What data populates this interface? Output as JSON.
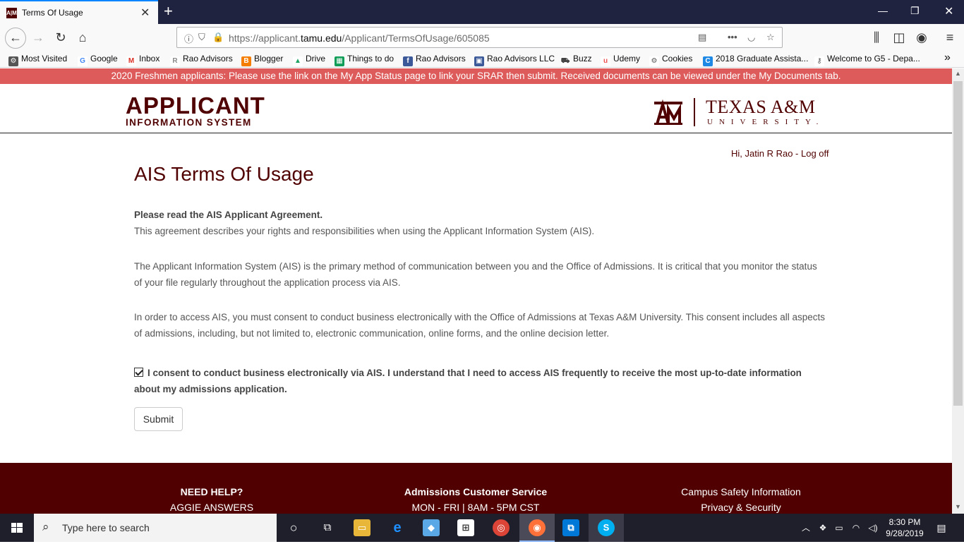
{
  "browser": {
    "tab_title": "Terms Of Usage",
    "tab_favicon": "A|M",
    "url_prefix": "https://applicant.",
    "url_domain": "tamu.edu",
    "url_path": "/Applicant/TermsOfUsage/605085",
    "bookmarks": [
      {
        "label": "Most Visited",
        "icon": "gear-icon",
        "color": "#555555"
      },
      {
        "label": "Google",
        "icon": "google-icon",
        "color": "#4285f4"
      },
      {
        "label": "Inbox",
        "icon": "gmail-icon",
        "color": "#d93025"
      },
      {
        "label": "Rao Advisors",
        "icon": "rao-icon",
        "color": "#8a8a8a"
      },
      {
        "label": "Blogger",
        "icon": "blogger-icon",
        "color": "#f57d00"
      },
      {
        "label": "Drive",
        "icon": "drive-icon",
        "color": "#1fa463"
      },
      {
        "label": "Things to do",
        "icon": "sheets-icon",
        "color": "#0f9d58"
      },
      {
        "label": "Rao Advisors",
        "icon": "facebook-icon",
        "color": "#3b5998"
      },
      {
        "label": "Rao Advisors LLC",
        "icon": "building-icon",
        "color": "#3b5998"
      },
      {
        "label": "Buzz",
        "icon": "buzz-icon",
        "color": "#444444"
      },
      {
        "label": "Udemy",
        "icon": "udemy-icon",
        "color": "#ec5252"
      },
      {
        "label": "Cookies",
        "icon": "gear-icon",
        "color": "#555555"
      },
      {
        "label": "2018 Graduate Assista...",
        "icon": "c-icon",
        "color": "#1e88e5"
      },
      {
        "label": "Welcome to G5 - Depa...",
        "icon": "key-icon",
        "color": "#555555"
      }
    ]
  },
  "announcement": "2020 Freshmen applicants: Please use the link on the My App Status page to link your SRAR then submit. Received documents can be viewed under the My Documents tab.",
  "header": {
    "logo_main": "APPLICANT",
    "logo_sub": "INFORMATION SYSTEM",
    "tamu_mark": "ĀM",
    "tamu_name": "TEXAS A&M",
    "tamu_univ": "UNIVERSITY."
  },
  "user": {
    "greeting": "Hi, Jatin R Rao - ",
    "logoff": "Log off"
  },
  "content": {
    "title": "AIS Terms Of Usage",
    "intro_bold": "Please read the AIS Applicant Agreement.",
    "intro_text": "This agreement describes your rights and responsibilities when using the Applicant Information System (AIS).",
    "para2": "The Applicant Information System (AIS) is the primary method of communication between you and the Office of Admissions. It is critical that you monitor the status of your file regularly throughout the application process via AIS.",
    "para3": "In order to access AIS, you must consent to conduct business electronically with the Office of Admissions at Texas A&M University. This consent includes all aspects of admissions, including, but not limited to, electronic communication, online forms, and the online decision letter.",
    "consent": "I consent to conduct business electronically via AIS. I understand that I need to access AIS frequently to receive the most up-to-date information about my admissions application.",
    "consent_checked": true,
    "submit": "Submit"
  },
  "footer": {
    "help_title": "NEED HELP?",
    "help_link": "AGGIE ANSWERS",
    "service_title": "Admissions Customer Service",
    "service_hours": "MON - FRI | 8AM - 5PM CST",
    "safety_link": "Campus Safety Information",
    "privacy_link": "Privacy & Security"
  },
  "taskbar": {
    "search_placeholder": "Type here to search",
    "time": "8:30 PM",
    "date": "9/28/2019"
  },
  "colors": {
    "maroon": "#500000",
    "announce": "#de5b5b",
    "taskbar": "#1f1f2b"
  }
}
